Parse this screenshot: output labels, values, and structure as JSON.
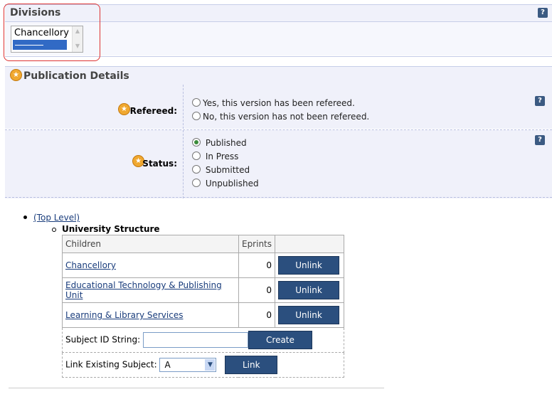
{
  "divisions": {
    "title": "Divisions",
    "help": "?",
    "options": [
      "Chancellory",
      ""
    ]
  },
  "publication": {
    "title": "Publication Details",
    "refereed": {
      "label": "Refereed:",
      "options": [
        "Yes, this version has been refereed.",
        "No, this version has not been refereed."
      ],
      "help": "?"
    },
    "status": {
      "label": "Status:",
      "options": [
        "Published",
        "In Press",
        "Submitted",
        "Unpublished"
      ],
      "selected": "Published",
      "help": "?"
    }
  },
  "subjects": {
    "top_level": "(Top Level)",
    "structure": "University Structure",
    "headers": {
      "children": "Children",
      "eprints": "Eprints"
    },
    "rows": [
      {
        "name": "Chancellory",
        "count": "0",
        "action": "Unlink"
      },
      {
        "name": "Educational Technology & Publishing Unit",
        "count": "0",
        "action": "Unlink"
      },
      {
        "name": "Learning & Library Services",
        "count": "0",
        "action": "Unlink"
      }
    ],
    "subject_id_label": "Subject ID String:",
    "subject_id_value": "",
    "create_label": "Create",
    "link_existing_label": "Link Existing Subject:",
    "link_existing_value": "A",
    "link_label": "Link"
  }
}
